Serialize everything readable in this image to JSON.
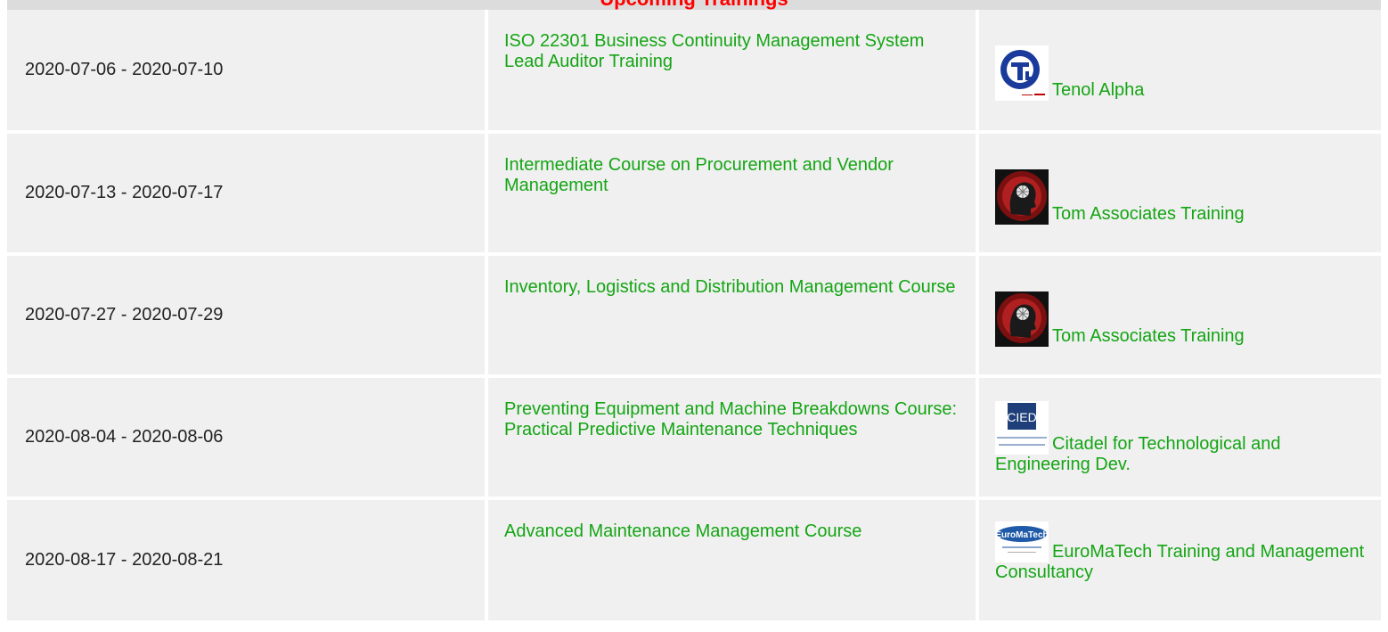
{
  "header": {
    "title": "Upcoming Trainings"
  },
  "rows": [
    {
      "date": "2020-07-06 - 2020-07-10",
      "course": "ISO 22301 Business Continuity Management System Lead Auditor Training",
      "provider": "Tenol Alpha",
      "logo_icon": "tenol-alpha-logo-icon"
    },
    {
      "date": "2020-07-13 - 2020-07-17",
      "course": "Intermediate Course on Procurement and Vendor Management",
      "provider": "Tom Associates Training",
      "logo_icon": "tom-associates-logo-icon"
    },
    {
      "date": "2020-07-27 - 2020-07-29",
      "course": "Inventory, Logistics and Distribution Management Course",
      "provider": "Tom Associates Training",
      "logo_icon": "tom-associates-logo-icon"
    },
    {
      "date": "2020-08-04 - 2020-08-06",
      "course": "Preventing Equipment and Machine Breakdowns Course: Practical Predictive Maintenance Techniques",
      "provider": "Citadel for Technological and Engineering Dev.",
      "logo_icon": "citadel-logo-icon"
    },
    {
      "date": "2020-08-17 - 2020-08-21",
      "course": "Advanced Maintenance Management Course",
      "provider": "EuroMaTech Training and Management Consultancy",
      "logo_icon": "euromatech-logo-icon"
    }
  ],
  "logos": {
    "citadel_text": "CIED",
    "euromatech_text": "EuroMaTech"
  },
  "colors": {
    "header_title": "#ff0000",
    "link": "#14a514",
    "row_bg": "#f0f0f0",
    "header_bg": "#dcdcdc"
  }
}
